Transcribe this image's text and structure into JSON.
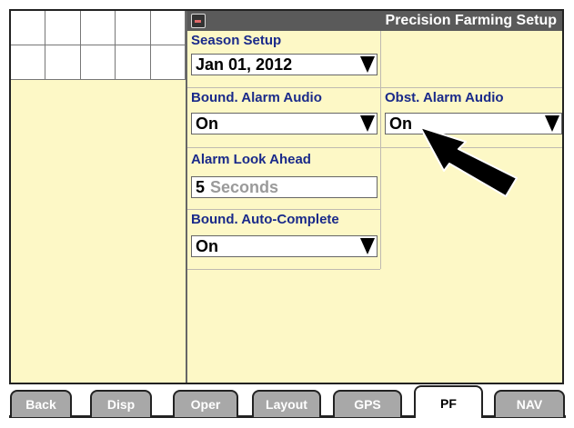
{
  "window": {
    "title": "Precision Farming Setup",
    "icon": "display-icon"
  },
  "fields": {
    "season_setup": {
      "label": "Season Setup",
      "value": "Jan 01, 2012"
    },
    "bound_alarm_audio": {
      "label": "Bound. Alarm Audio",
      "value": "On"
    },
    "obst_alarm_audio": {
      "label": "Obst. Alarm Audio",
      "value": "On"
    },
    "alarm_look_ahead": {
      "label": "Alarm Look Ahead",
      "value": "5",
      "unit": "Seconds"
    },
    "bound_auto_complete": {
      "label": "Bound. Auto-Complete",
      "value": "On"
    }
  },
  "tabs": [
    "Back",
    "Disp",
    "Oper",
    "Layout",
    "GPS",
    "PF",
    "NAV"
  ],
  "active_tab": "PF",
  "colors": {
    "screen_bg": "#fdf8c6",
    "label": "#1a2a8a",
    "titlebar": "#5a5a5a",
    "tab": "#a8a8a8"
  }
}
